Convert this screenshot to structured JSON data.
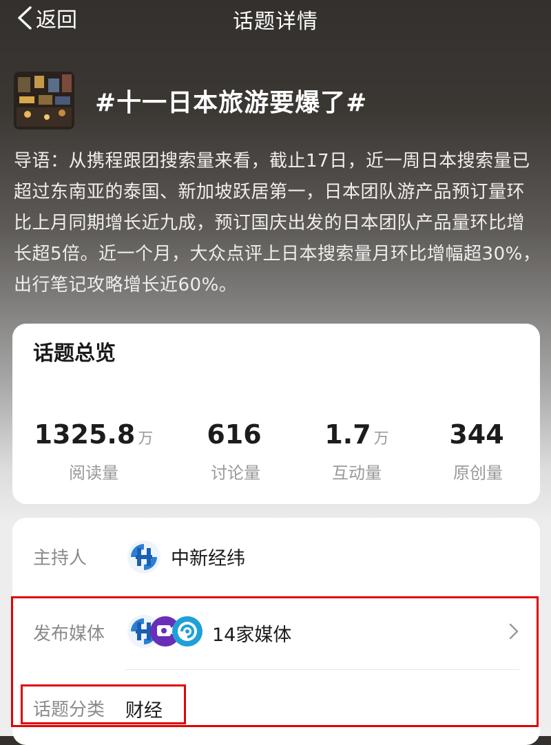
{
  "nav": {
    "back_label": "返回",
    "title": "话题详情"
  },
  "topic": {
    "title": "#十一日本旅游要爆了#",
    "intro": "导语：从携程跟团搜索量来看，截止17日，近一周日本搜索量已超过东南亚的泰国、新加坡跃居第一，日本团队游产品预订量环比上月同期增长近九成，预订国庆出发的日本团队产品量环比增长超5倍。近一个月，大众点评上日本搜索量月环比增幅超30%，出行笔记攻略增长近60%。"
  },
  "overview": {
    "heading": "话题总览",
    "stats": [
      {
        "value": "1325.8",
        "unit": "万",
        "label": "阅读量"
      },
      {
        "value": "616",
        "unit": "",
        "label": "讨论量"
      },
      {
        "value": "1.7",
        "unit": "万",
        "label": "互动量"
      },
      {
        "value": "344",
        "unit": "",
        "label": "原创量"
      }
    ]
  },
  "info": {
    "host_label": "主持人",
    "host_name": "中新经纬",
    "host_icon": "zhongxin-logo-icon",
    "media_label": "发布媒体",
    "media_count": "14家媒体",
    "media_icons": [
      "zhongxin-logo-icon",
      "media-logo-purple-icon",
      "media-logo-blue-icon"
    ],
    "category_label": "话题分类",
    "category_value": "财经"
  },
  "colors": {
    "highlight": "#e10000",
    "logo_blue": "#2a7fd6"
  }
}
